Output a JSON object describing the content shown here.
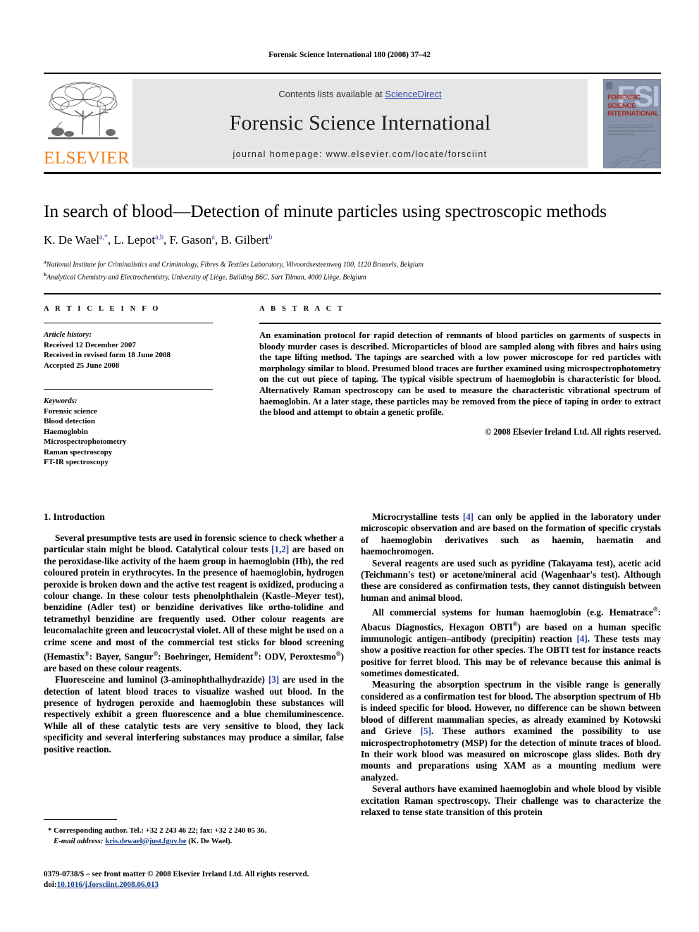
{
  "running_head": "Forensic Science International 180 (2008) 37–42",
  "masthead": {
    "contents_prefix": "Contents lists available at ",
    "contents_link": "ScienceDirect",
    "journal_name": "Forensic Science International",
    "homepage": "journal homepage: www.elsevier.com/locate/forsciint",
    "publisher_name": "ELSEVIER",
    "publisher_logo_icon": "elsevier-tree-icon",
    "cover": {
      "acronym": "FSI",
      "line1": "FORENSIC",
      "line2": "SCIENCE",
      "line3": "INTERNATIONAL",
      "subtitle": "An International Journal Dedicated to the Applications of Medicine and Science in the Administration of Justice"
    }
  },
  "article": {
    "title": "In search of blood—Detection of minute particles using spectroscopic methods",
    "authors": [
      {
        "name": "K. De Wael",
        "marks": "a,*"
      },
      {
        "name": "L. Lepot",
        "marks": "a,b"
      },
      {
        "name": "F. Gason",
        "marks": "a"
      },
      {
        "name": "B. Gilbert",
        "marks": "b"
      }
    ],
    "affiliations": [
      {
        "mark": "a",
        "text": "National Institute for Criminalistics and Criminology, Fibres & Textiles Laboratory, Vilvoordsesteenweg 100, 1120 Brussels, Belgium"
      },
      {
        "mark": "b",
        "text": "Analytical Chemistry and Electrochemistry, University of Liège, Building B6C, Sart Tilman, 4000 Liège, Belgium"
      }
    ]
  },
  "article_info": {
    "heading": "A R T I C L E   I N F O",
    "history_label": "Article history:",
    "history": [
      "Received 12 December 2007",
      "Received in revised form 18 June 2008",
      "Accepted 25 June 2008"
    ],
    "keywords_label": "Keywords:",
    "keywords": [
      "Forensic science",
      "Blood detection",
      "Haemoglobin",
      "Microspectrophotometry",
      "Raman spectroscopy",
      "FT-IR spectroscopy"
    ]
  },
  "abstract": {
    "heading": "A B S T R A C T",
    "text": "An examination protocol for rapid detection of remnants of blood particles on garments of suspects in bloody murder cases is described. Microparticles of blood are sampled along with fibres and hairs using the tape lifting method. The tapings are searched with a low power microscope for red particles with morphology similar to blood. Presumed blood traces are further examined using microspectrophotometry on the cut out piece of taping. The typical visible spectrum of haemoglobin is characteristic for blood. Alternatively Raman spectroscopy can be used to measure the characteristic vibrational spectrum of haemoglobin. At a later stage, these particles may be removed from the piece of taping in order to extract the blood and attempt to obtain a genetic profile.",
    "copyright": "© 2008 Elsevier Ireland Ltd. All rights reserved."
  },
  "body": {
    "section_number_title": "1. Introduction",
    "left_paragraphs": [
      "Several presumptive tests are used in forensic science to check whether a particular stain might be blood. Catalytical colour tests [1,2] are based on the peroxidase-like activity of the haem group in haemoglobin (Hb), the red coloured protein in erythrocytes. In the presence of haemoglobin, hydrogen peroxide is broken down and the active test reagent is oxidized, producing a colour change. In these colour tests phenolphthalein (Kastle–Meyer test), benzidine (Adler test) or benzidine derivatives like ortho-tolidine and tetramethyl benzidine are frequently used. Other colour reagents are leucomalachite green and leucocrystal violet. All of these might be used on a crime scene and most of the commercial test sticks for blood screening (Hemastix®: Bayer, Sangur®: Boehringer, Hemident®: ODV, Peroxtesmo®) are based on these colour reagents.",
      "Fluoresceine and luminol (3-aminophthalhydrazide) [3] are used in the detection of latent blood traces to visualize washed out blood. In the presence of hydrogen peroxide and haemoglobin these substances will respectively exhibit a green fluorescence and a blue chemiluminescence. While all of these catalytic tests are very sensitive to blood, they lack specificity and several interfering substances may produce a similar, false positive reaction."
    ],
    "right_paragraphs": [
      "Microcrystalline tests [4] can only be applied in the laboratory under microscopic observation and are based on the formation of specific crystals of haemoglobin derivatives such as haemin, haematin and haemochromogen.",
      "Several reagents are used such as pyridine (Takayama test), acetic acid (Teichmann's test) or acetone/mineral acid (Wagenhaar's test). Although these are considered as confirmation tests, they cannot distinguish between human and animal blood.",
      "All commercial systems for human haemoglobin (e.g. Hematrace®: Abacus Diagnostics, Hexagon OBTI®) are based on a human specific immunologic antigen–antibody (precipitin) reaction [4]. These tests may show a positive reaction for other species. The OBTI test for instance reacts positive for ferret blood. This may be of relevance because this animal is sometimes domesticated.",
      "Measuring the absorption spectrum in the visible range is generally considered as a confirmation test for blood. The absorption spectrum of Hb is indeed specific for blood. However, no difference can be shown between blood of different mammalian species, as already examined by Kotowski and Grieve [5]. These authors examined the possibility to use microspectrophotometry (MSP) for the detection of minute traces of blood. In their work blood was measured on microscope glass slides. Both dry mounts and preparations using XAM as a mounting medium were analyzed.",
      "Several authors have examined haemoglobin and whole blood by visible excitation Raman spectroscopy. Their challenge was to characterize the relaxed to tense state transition of this protein"
    ]
  },
  "footnotes": {
    "corresponding": "* Corresponding author. Tel.: +32 2 243 46 22; fax: +32 2 240 05 36.",
    "email_label": "E-mail address:",
    "email": "kris.dewael@just.fgov.be",
    "email_owner": "(K. De Wael).",
    "imprint_line1": "0379-0738/$ – see front matter © 2008 Elsevier Ireland Ltd. All rights reserved.",
    "imprint_doi_label": "doi:",
    "imprint_doi": "10.1016/j.forsciint.2008.06.013"
  },
  "colors": {
    "link_blue": "#2b3fa0",
    "elsevier_orange": "#F07F1A",
    "panel_gray": "#e6e6e6",
    "cover_bg": "#8892a6",
    "cover_red": "#a32a22"
  }
}
